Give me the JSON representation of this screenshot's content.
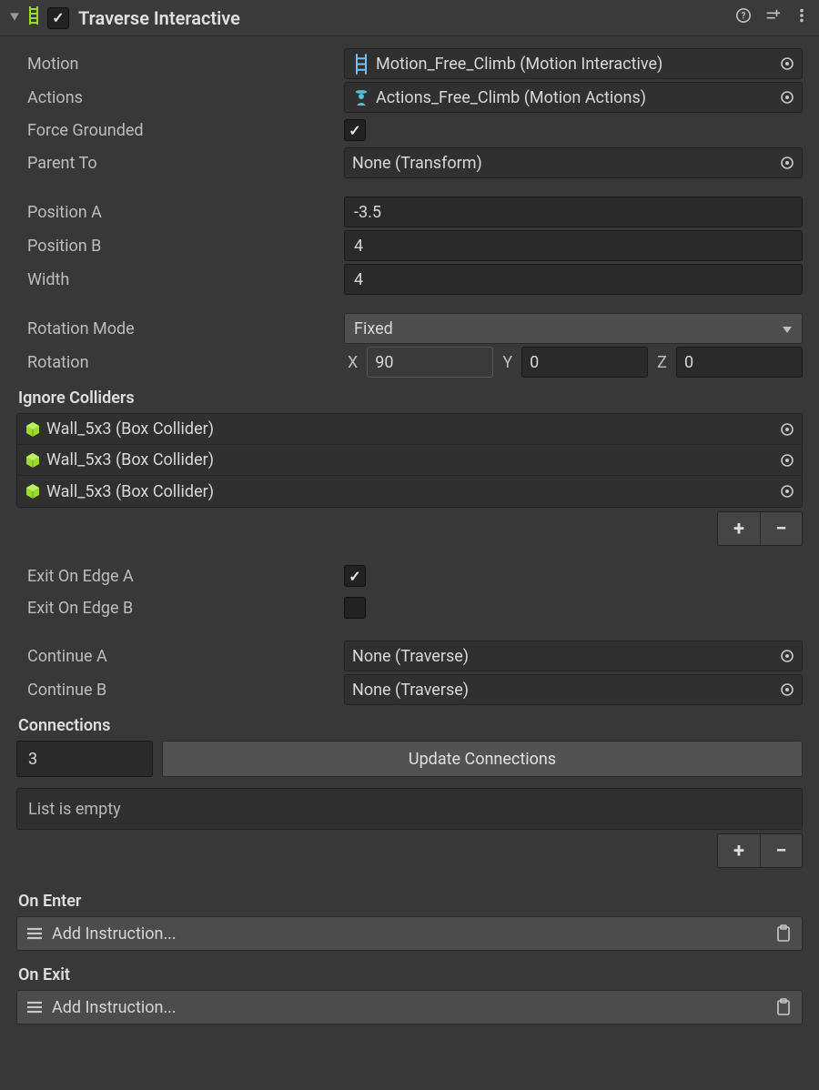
{
  "header": {
    "title": "Traverse Interactive",
    "enabled": true
  },
  "motion": {
    "label": "Motion",
    "value": "Motion_Free_Climb (Motion Interactive)"
  },
  "actions": {
    "label": "Actions",
    "value": "Actions_Free_Climb (Motion Actions)"
  },
  "forceGrounded": {
    "label": "Force Grounded",
    "value": true
  },
  "parentTo": {
    "label": "Parent To",
    "value": "None (Transform)"
  },
  "positionA": {
    "label": "Position A",
    "value": "-3.5"
  },
  "positionB": {
    "label": "Position B",
    "value": "4"
  },
  "width": {
    "label": "Width",
    "value": "4"
  },
  "rotationMode": {
    "label": "Rotation Mode",
    "value": "Fixed"
  },
  "rotation": {
    "label": "Rotation",
    "x": "90",
    "y": "0",
    "z": "0"
  },
  "ignoreColliders": {
    "label": "Ignore Colliders",
    "items": [
      "Wall_5x3 (Box Collider)",
      "Wall_5x3 (Box Collider)",
      "Wall_5x3 (Box Collider)"
    ]
  },
  "exitOnEdgeA": {
    "label": "Exit On Edge A",
    "value": true
  },
  "exitOnEdgeB": {
    "label": "Exit On Edge B",
    "value": false
  },
  "continueA": {
    "label": "Continue A",
    "value": "None (Traverse)"
  },
  "continueB": {
    "label": "Continue B",
    "value": "None (Traverse)"
  },
  "connections": {
    "label": "Connections",
    "count": "3",
    "button": "Update Connections",
    "empty": "List is empty"
  },
  "onEnter": {
    "label": "On Enter",
    "placeholder": "Add Instruction..."
  },
  "onExit": {
    "label": "On Exit",
    "placeholder": "Add Instruction..."
  },
  "glyphs": {
    "x": "X",
    "y": "Y",
    "z": "Z",
    "plus": "+",
    "minus": "−"
  }
}
